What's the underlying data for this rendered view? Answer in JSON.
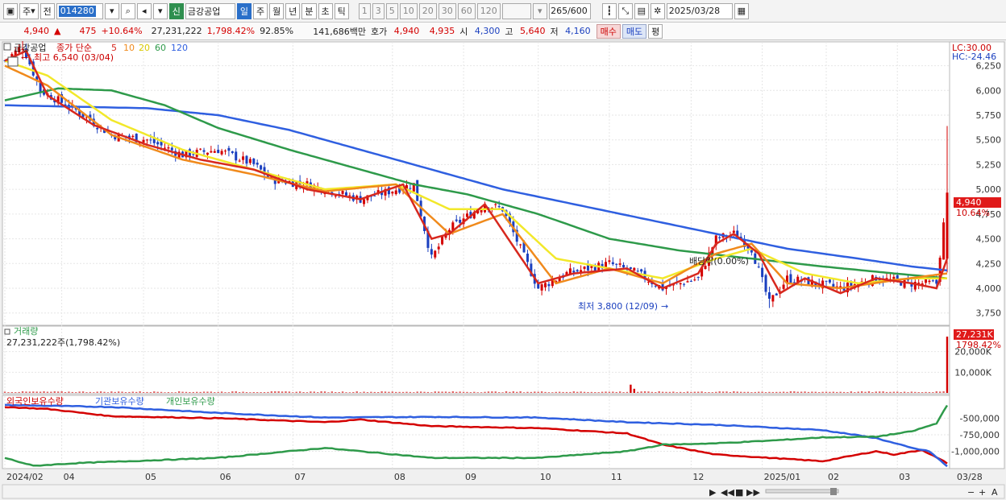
{
  "toolbar": {
    "market_select": "주",
    "prev_label": "전",
    "code": "014280",
    "tag_new": "신",
    "stock_name": "금강공업",
    "periods": [
      "일",
      "주",
      "월",
      "년",
      "분",
      "초",
      "틱"
    ],
    "active_period": "일",
    "minutes": [
      "1",
      "3",
      "5",
      "10",
      "20",
      "30",
      "60",
      "120"
    ],
    "count_value": "265",
    "count_total": "/600",
    "date": "2025/03/28"
  },
  "quote": {
    "price": "4,940",
    "arrow": "▲",
    "change": "475",
    "change_pct": "+10.64%",
    "volume": "27,231,222",
    "volume_pct": "1,798.42%",
    "ratio": "92.85%",
    "amount": "141,686백만",
    "ask_label": "호가",
    "ask": "4,940",
    "bid": "4,935",
    "open_label": "시",
    "open": "4,300",
    "high_label": "고",
    "high": "5,640",
    "low_label": "저",
    "low": "4,160",
    "buy": "매수",
    "sell": "매도",
    "eval": "평"
  },
  "legend": {
    "stock": "금강공업",
    "ma_title": "종가 단순",
    "ma_periods": [
      "5",
      "10",
      "20",
      "60",
      "120"
    ],
    "high_note": "최고 6,540 (03/04)",
    "low_note": "최저 3,800 (12/09)",
    "dividend_note": "배당락(0.00%)",
    "lc": "LC:30.00",
    "hc": "HC:-24.46",
    "current_price_tag": "4,940",
    "current_pct_tag": "10.64%"
  },
  "volume_panel": {
    "title": "거래량",
    "info": "27,231,222주(1,798.42%)",
    "current_tag": "27,231K",
    "current_pct": "1798.42%"
  },
  "holding_panel": {
    "titles": [
      "외국인보유수량",
      "기관보유수량",
      "개인보유수량"
    ]
  },
  "colors": {
    "ma5": "#d7281e",
    "ma10": "#f08a1c",
    "ma20": "#f2e82a",
    "ma60": "#2e9a4a",
    "ma120": "#2f5fe0",
    "up": "#d40000",
    "down": "#1a3fbf"
  },
  "chart_data": [
    {
      "type": "line",
      "name": "price",
      "y_ticks": [
        "6,250",
        "6,000",
        "5,750",
        "5,500",
        "5,250",
        "5,000",
        "4,750",
        "4,500",
        "4,250",
        "4,000",
        "3,750"
      ],
      "ylim": [
        3650,
        6450
      ],
      "x_ticks": [
        "2024/02",
        "04",
        "05",
        "06",
        "07",
        "08",
        "09",
        "10",
        "11",
        "12",
        "2025/01",
        "02",
        "03",
        "03/28"
      ],
      "close_keypoints": [
        [
          0,
          6300
        ],
        [
          5,
          6450
        ],
        [
          10,
          6000
        ],
        [
          20,
          5800
        ],
        [
          30,
          5550
        ],
        [
          40,
          5500
        ],
        [
          50,
          5350
        ],
        [
          60,
          5400
        ],
        [
          70,
          5250
        ],
        [
          75,
          5100
        ],
        [
          85,
          5050
        ],
        [
          95,
          4950
        ],
        [
          100,
          4900
        ],
        [
          110,
          5000
        ],
        [
          115,
          5050
        ],
        [
          120,
          4300
        ],
        [
          125,
          4600
        ],
        [
          135,
          4850
        ],
        [
          140,
          4800
        ],
        [
          150,
          4000
        ],
        [
          158,
          4150
        ],
        [
          170,
          4250
        ],
        [
          178,
          4150
        ],
        [
          185,
          4000
        ],
        [
          195,
          4100
        ],
        [
          200,
          4500
        ],
        [
          205,
          4550
        ],
        [
          210,
          4400
        ],
        [
          215,
          3850
        ],
        [
          220,
          4100
        ],
        [
          228,
          4050
        ],
        [
          235,
          4000
        ],
        [
          245,
          4100
        ],
        [
          255,
          4050
        ],
        [
          262,
          4050
        ],
        [
          265,
          4940
        ]
      ],
      "ma5": [
        [
          0,
          6300
        ],
        [
          6,
          6400
        ],
        [
          12,
          5950
        ],
        [
          25,
          5650
        ],
        [
          40,
          5450
        ],
        [
          55,
          5300
        ],
        [
          70,
          5200
        ],
        [
          85,
          5000
        ],
        [
          100,
          4900
        ],
        [
          112,
          5050
        ],
        [
          120,
          4500
        ],
        [
          125,
          4550
        ],
        [
          135,
          4850
        ],
        [
          150,
          4050
        ],
        [
          160,
          4150
        ],
        [
          175,
          4200
        ],
        [
          185,
          4000
        ],
        [
          195,
          4150
        ],
        [
          200,
          4450
        ],
        [
          205,
          4550
        ],
        [
          212,
          4350
        ],
        [
          218,
          3950
        ],
        [
          225,
          4100
        ],
        [
          235,
          3950
        ],
        [
          245,
          4100
        ],
        [
          255,
          4050
        ],
        [
          262,
          4000
        ],
        [
          265,
          4300
        ]
      ],
      "ma10": [
        [
          0,
          6250
        ],
        [
          12,
          6050
        ],
        [
          30,
          5550
        ],
        [
          50,
          5300
        ],
        [
          70,
          5150
        ],
        [
          90,
          4980
        ],
        [
          110,
          5050
        ],
        [
          125,
          4550
        ],
        [
          140,
          4750
        ],
        [
          155,
          4050
        ],
        [
          170,
          4200
        ],
        [
          185,
          4050
        ],
        [
          200,
          4350
        ],
        [
          210,
          4450
        ],
        [
          220,
          4050
        ],
        [
          235,
          4000
        ],
        [
          250,
          4080
        ],
        [
          265,
          4150
        ]
      ],
      "ma20": [
        [
          0,
          6300
        ],
        [
          12,
          6150
        ],
        [
          30,
          5700
        ],
        [
          50,
          5400
        ],
        [
          70,
          5200
        ],
        [
          90,
          5000
        ],
        [
          110,
          5050
        ],
        [
          125,
          4800
        ],
        [
          140,
          4800
        ],
        [
          155,
          4300
        ],
        [
          170,
          4200
        ],
        [
          185,
          4100
        ],
        [
          200,
          4300
        ],
        [
          210,
          4400
        ],
        [
          225,
          4150
        ],
        [
          240,
          4050
        ],
        [
          255,
          4100
        ],
        [
          265,
          4100
        ]
      ],
      "ma60": [
        [
          0,
          5900
        ],
        [
          15,
          6020
        ],
        [
          30,
          6000
        ],
        [
          45,
          5850
        ],
        [
          60,
          5620
        ],
        [
          80,
          5400
        ],
        [
          100,
          5200
        ],
        [
          115,
          5050
        ],
        [
          130,
          4950
        ],
        [
          150,
          4750
        ],
        [
          170,
          4500
        ],
        [
          190,
          4380
        ],
        [
          210,
          4300
        ],
        [
          230,
          4220
        ],
        [
          250,
          4150
        ],
        [
          265,
          4100
        ]
      ],
      "ma120": [
        [
          0,
          5850
        ],
        [
          40,
          5820
        ],
        [
          60,
          5750
        ],
        [
          80,
          5600
        ],
        [
          100,
          5400
        ],
        [
          120,
          5200
        ],
        [
          140,
          5000
        ],
        [
          160,
          4850
        ],
        [
          180,
          4700
        ],
        [
          200,
          4550
        ],
        [
          220,
          4400
        ],
        [
          240,
          4300
        ],
        [
          255,
          4220
        ],
        [
          265,
          4180
        ]
      ]
    },
    {
      "type": "bar",
      "name": "volume",
      "y_ticks": [
        "20,000K",
        "10,000K"
      ],
      "ylim": [
        0,
        30000
      ],
      "spikes": [
        [
          176,
          4000
        ],
        [
          177,
          2000
        ],
        [
          265,
          27231
        ]
      ]
    },
    {
      "type": "line",
      "name": "holdings",
      "y_ticks": [
        "-500,000",
        "-750,000",
        "-1,000,000"
      ],
      "ylim": [
        -1250000,
        -300000
      ],
      "series": [
        {
          "name": "외국인보유수량",
          "color": "#d40000",
          "points": [
            [
              0,
              -330000
            ],
            [
              12,
              -360000
            ],
            [
              30,
              -470000
            ],
            [
              60,
              -500000
            ],
            [
              90,
              -560000
            ],
            [
              100,
              -520000
            ],
            [
              120,
              -620000
            ],
            [
              150,
              -650000
            ],
            [
              175,
              -730000
            ],
            [
              185,
              -900000
            ],
            [
              200,
              -1050000
            ],
            [
              215,
              -1100000
            ],
            [
              230,
              -1150000
            ],
            [
              245,
              -1000000
            ],
            [
              250,
              -1050000
            ],
            [
              258,
              -980000
            ],
            [
              265,
              -1180000
            ]
          ]
        },
        {
          "name": "기관보유수량",
          "color": "#2f5fe0",
          "points": [
            [
              0,
              -300000
            ],
            [
              30,
              -330000
            ],
            [
              60,
              -420000
            ],
            [
              90,
              -490000
            ],
            [
              120,
              -480000
            ],
            [
              150,
              -490000
            ],
            [
              175,
              -560000
            ],
            [
              200,
              -600000
            ],
            [
              230,
              -680000
            ],
            [
              245,
              -800000
            ],
            [
              255,
              -950000
            ],
            [
              260,
              -1000000
            ],
            [
              265,
              -1230000
            ]
          ]
        },
        {
          "name": "개인보유수량",
          "color": "#2e9a4a",
          "points": [
            [
              0,
              -1100000
            ],
            [
              8,
              -1220000
            ],
            [
              20,
              -1180000
            ],
            [
              60,
              -1100000
            ],
            [
              90,
              -950000
            ],
            [
              120,
              -1100000
            ],
            [
              150,
              -1100000
            ],
            [
              175,
              -1000000
            ],
            [
              185,
              -900000
            ],
            [
              200,
              -880000
            ],
            [
              215,
              -840000
            ],
            [
              230,
              -790000
            ],
            [
              245,
              -780000
            ],
            [
              255,
              -700000
            ],
            [
              262,
              -580000
            ],
            [
              265,
              -300000
            ]
          ]
        }
      ]
    }
  ]
}
